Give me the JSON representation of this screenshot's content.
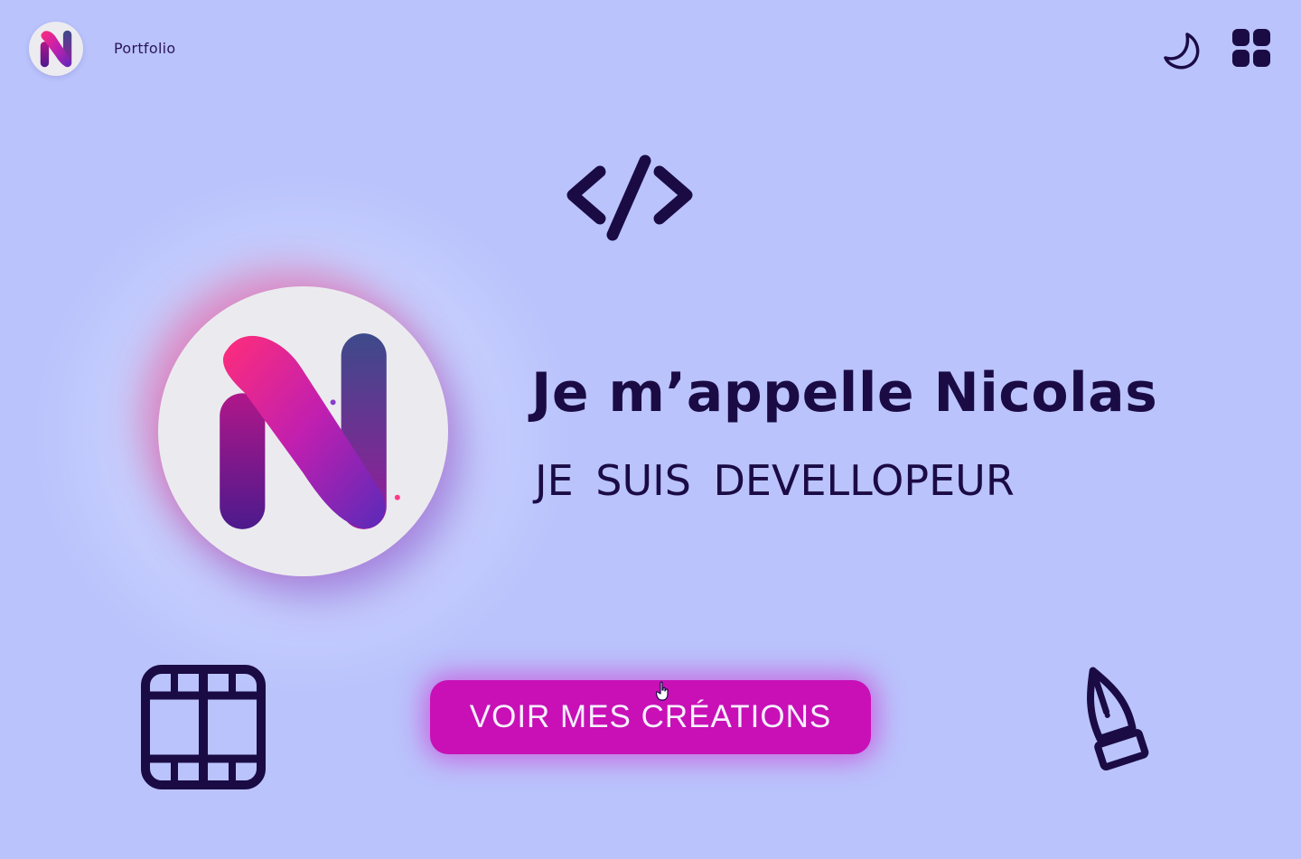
{
  "header": {
    "brand": "Portfolio",
    "logo_icon": "n-logo-icon",
    "theme_toggle_icon": "moon-icon",
    "menu_icon": "apps-grid-icon"
  },
  "hero": {
    "headline": "Je m’appelle Nicolas",
    "subheadline": "JE SUIS DEVELLOPEUR",
    "cta_label": "VOIR MES CRÉATIONS"
  },
  "decorative_icons": [
    "code-icon",
    "film-icon",
    "pen-tool-icon",
    "hand-cursor-icon"
  ],
  "colors": {
    "background": "#bac3fc",
    "text": "#1b0b45",
    "cta": "#c810b6",
    "cta_text": "#f6f0ff",
    "logo_pink": "#ff2d7a",
    "logo_purple": "#5a1d9e"
  }
}
